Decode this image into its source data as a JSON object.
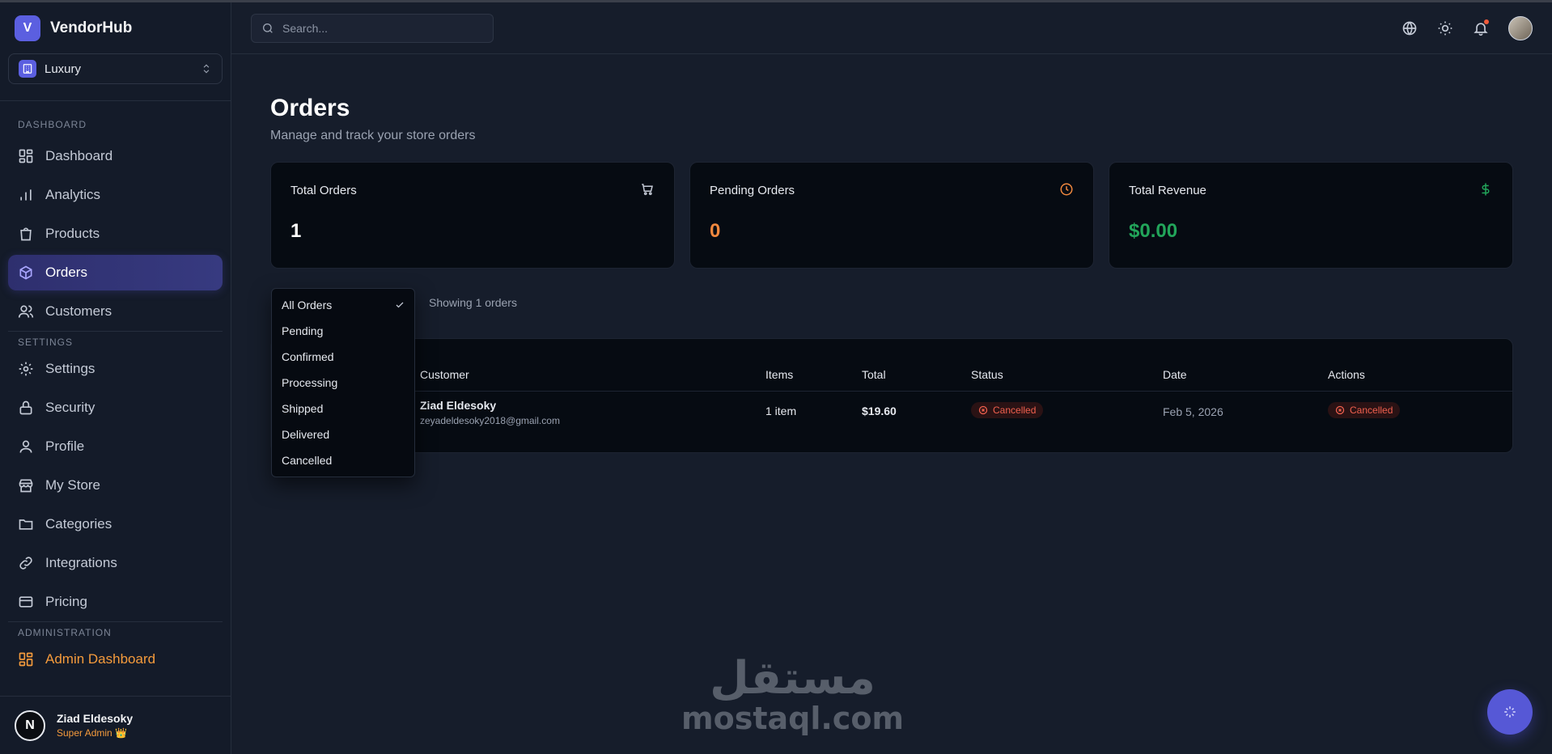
{
  "brand": {
    "logo_letter": "V",
    "name": "VendorHub"
  },
  "store": {
    "selected": "Luxury"
  },
  "sidebar": {
    "section_dashboard": "DASHBOARD",
    "section_settings": "SETTINGS",
    "section_admin": "ADMINISTRATION",
    "items": [
      {
        "label": "Dashboard",
        "icon": "dashboard-icon"
      },
      {
        "label": "Analytics",
        "icon": "bar-chart-icon"
      },
      {
        "label": "Products",
        "icon": "bag-icon"
      },
      {
        "label": "Orders",
        "icon": "box-icon"
      },
      {
        "label": "Customers",
        "icon": "users-icon"
      },
      {
        "label": "Settings",
        "icon": "gear-icon"
      },
      {
        "label": "Security",
        "icon": "lock-icon"
      },
      {
        "label": "Profile",
        "icon": "user-icon"
      },
      {
        "label": "My Store",
        "icon": "store-icon"
      },
      {
        "label": "Categories",
        "icon": "folder-icon"
      },
      {
        "label": "Integrations",
        "icon": "link-icon"
      },
      {
        "label": "Pricing",
        "icon": "card-icon"
      },
      {
        "label": "Admin Dashboard",
        "icon": "admin-grid-icon"
      }
    ],
    "active": "Orders"
  },
  "user": {
    "initial": "N",
    "name": "Ziad Eldesoky",
    "role": "Super Admin 👑"
  },
  "search": {
    "placeholder": "Search..."
  },
  "page": {
    "title": "Orders",
    "subtitle": "Manage and track your store orders"
  },
  "stats": [
    {
      "label": "Total Orders",
      "value": "1",
      "icon": "cart-icon",
      "color": "#ffffff"
    },
    {
      "label": "Pending Orders",
      "value": "0",
      "icon": "clock-icon",
      "color": "#f0883e"
    },
    {
      "label": "Total Revenue",
      "value": "$0.00",
      "icon": "dollar-icon",
      "color": "#22a55a"
    }
  ],
  "filter": {
    "options": [
      "All Orders",
      "Pending",
      "Confirmed",
      "Processing",
      "Shipped",
      "Delivered",
      "Cancelled"
    ],
    "selected": "All Orders",
    "showing": "Showing 1 orders"
  },
  "table": {
    "columns": [
      "Customer",
      "Items",
      "Total",
      "Status",
      "Date",
      "Actions"
    ],
    "rows": [
      {
        "customer_name": "Ziad Eldesoky",
        "customer_email": "zeyadeldesoky2018@gmail.com",
        "items": "1 item",
        "total": "$19.60",
        "status": "Cancelled",
        "date": "Feb 5, 2026",
        "action": "Cancelled"
      }
    ]
  },
  "watermark": {
    "arabic": "مستقل",
    "latin": "mostaql.com"
  },
  "colors": {
    "accent": "#5b5fe0",
    "admin": "#f59b3c",
    "danger": "#f0604e"
  }
}
